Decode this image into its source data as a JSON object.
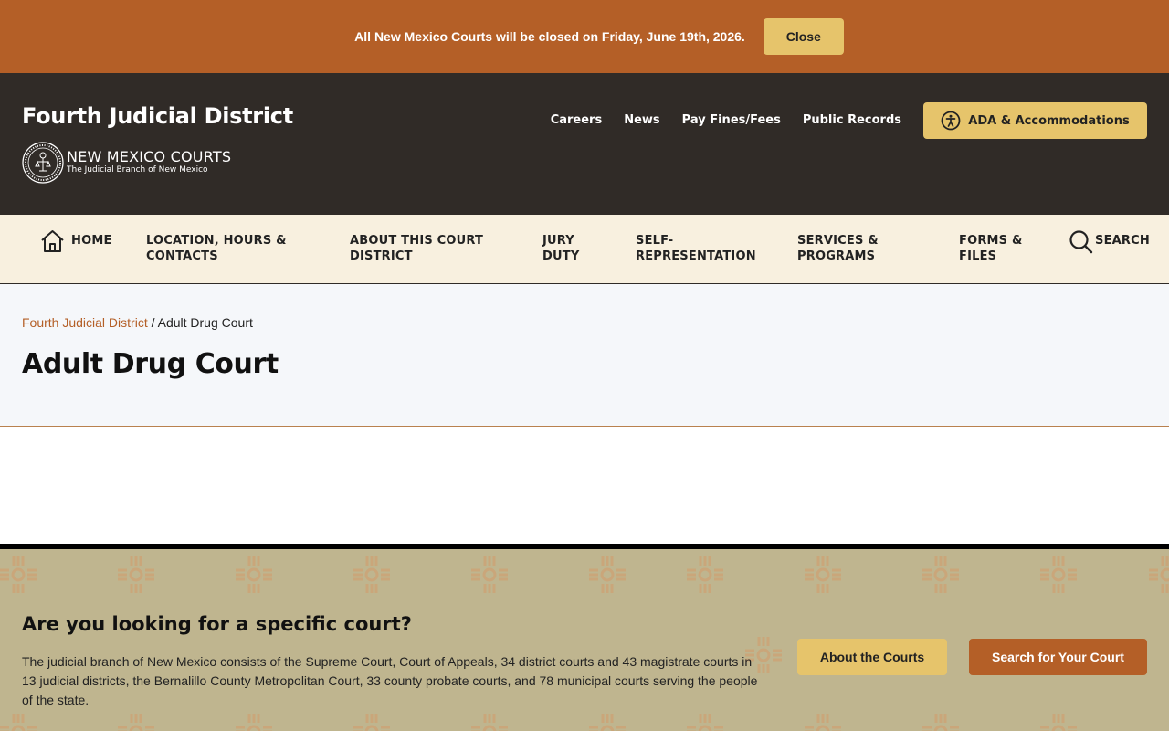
{
  "alert": {
    "message": "All New Mexico Courts will be closed on Friday, June 19th, 2026.",
    "close_label": "Close"
  },
  "header": {
    "site_title": "Fourth Judicial District",
    "logo_main": "NEW MEXICO COURTS",
    "logo_sub": "The Judicial Branch of New Mexico",
    "links": [
      "Careers",
      "News",
      "Pay Fines/Fees",
      "Public Records"
    ],
    "ada_label": "ADA & Accommodations"
  },
  "nav": {
    "home": "HOME",
    "location": "LOCATION, HOURS & CONTACTS",
    "about": "ABOUT THIS COURT DISTRICT",
    "jury": "JURY DUTY",
    "self_rep": "SELF-REPRESENTATION",
    "services": "SERVICES & PROGRAMS",
    "forms": "FORMS & FILES",
    "search": "SEARCH"
  },
  "breadcrumb": {
    "parent": "Fourth Judicial District",
    "separator": " / ",
    "current": "Adult Drug Court"
  },
  "page": {
    "title": "Adult Drug Court"
  },
  "cta": {
    "title": "Are you looking for a specific court?",
    "body": "The judicial branch of New Mexico consists of the Supreme Court, Court of Appeals, 34 district courts and 43 magistrate courts in 13 judicial districts, the Bernalillo County Metropolitan Court, 33 county probate courts, and 78 municipal courts serving the people of the state.",
    "about_label": "About the Courts",
    "search_label": "Search for Your Court"
  },
  "colors": {
    "accent": "#b45f27",
    "gold": "#e6c46b",
    "header_bg": "#302b27",
    "nav_bg": "#f8f0df",
    "cta_bg": "#bfb58f"
  },
  "icons": [
    "home-icon",
    "search-icon",
    "accessibility-icon",
    "court-seal-icon",
    "zia-pattern"
  ]
}
